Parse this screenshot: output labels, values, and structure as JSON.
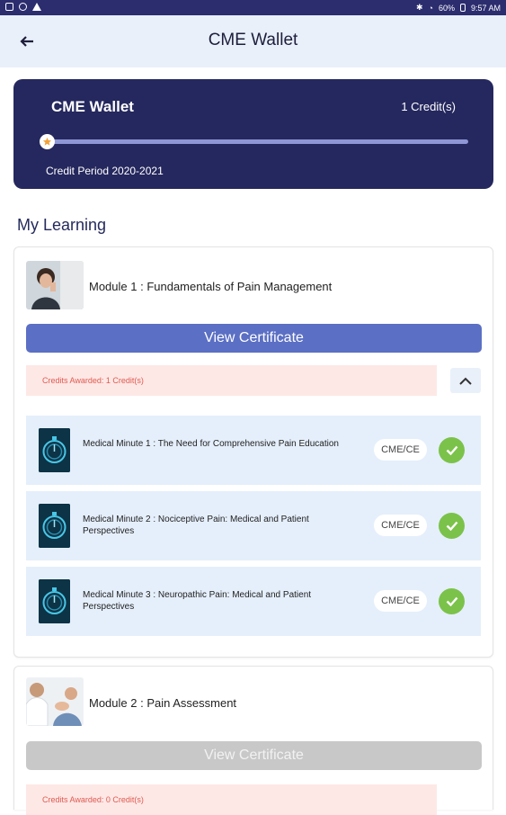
{
  "status_bar": {
    "battery": "60%",
    "time": "9:57 AM"
  },
  "header": {
    "title": "CME Wallet"
  },
  "wallet": {
    "title": "CME Wallet",
    "credits": "1 Credit(s)",
    "period": "Credit Period 2020-2021",
    "progress": 0
  },
  "section_title": "My Learning",
  "modules": [
    {
      "title": "Module 1 : Fundamentals of Pain Management",
      "certificate_label": "View Certificate",
      "credits_awarded": "Credits Awarded: 1 Credit(s)",
      "lessons": [
        {
          "title": "Medical Minute 1 : The Need for Comprehensive Pain Education",
          "badge": "CME/CE"
        },
        {
          "title": "Medical Minute 2 : Nociceptive Pain: Medical and Patient Perspectives",
          "badge": "CME/CE"
        },
        {
          "title": "Medical Minute 3 : Neuropathic Pain: Medical and Patient Perspectives",
          "badge": "CME/CE"
        }
      ]
    },
    {
      "title": "Module 2 : Pain Assessment",
      "certificate_label": "View Certificate",
      "credits_awarded": "Credits Awarded: 0 Credit(s)"
    }
  ],
  "colors": {
    "primary": "#25285e",
    "button_active": "#5b6fc4",
    "button_disabled": "#c8c8c8",
    "check": "#7bc24a"
  }
}
